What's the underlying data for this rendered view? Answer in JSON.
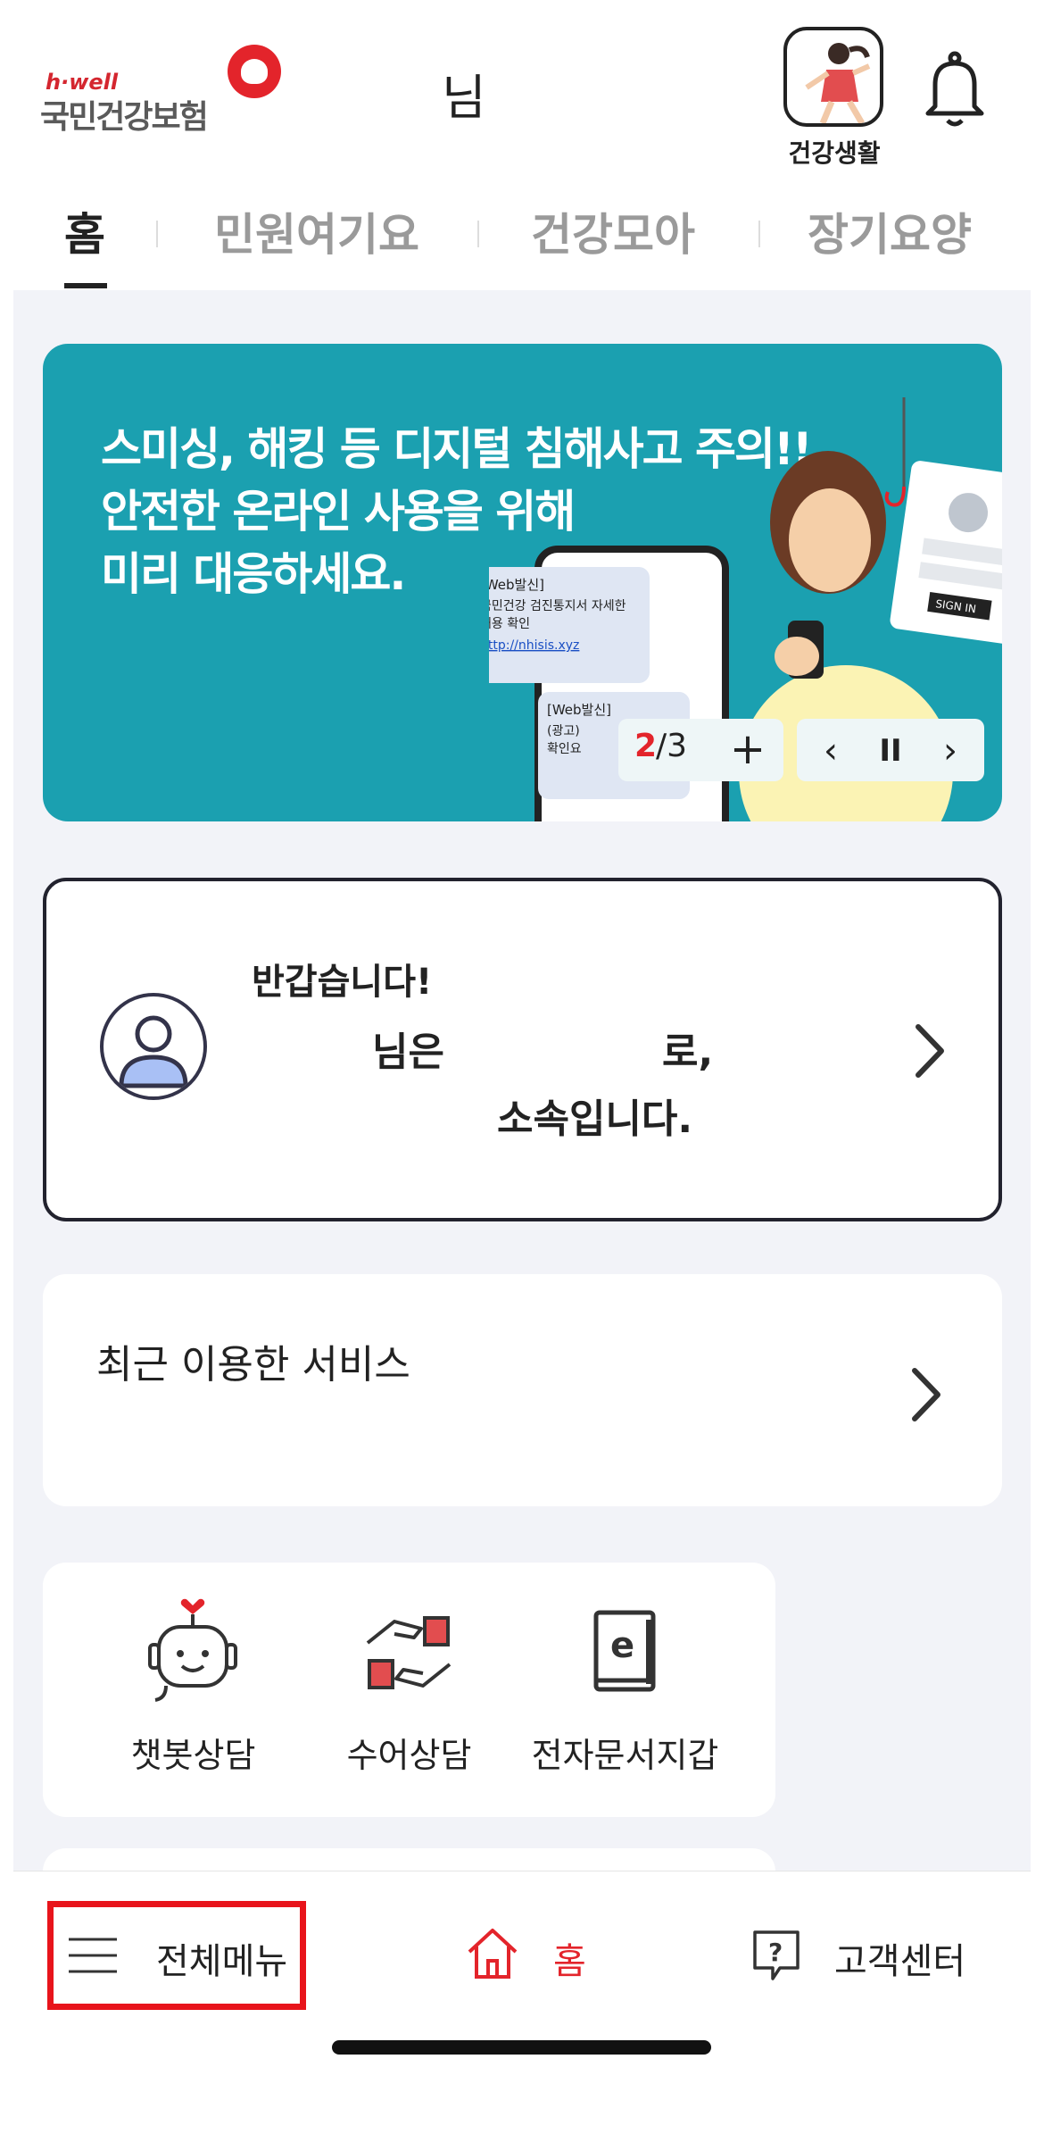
{
  "header": {
    "logo_tagline": "h·well",
    "logo_name": "국민건강보험",
    "username_suffix": "님",
    "life_label": "건강생활"
  },
  "tabs": [
    {
      "label": "홈",
      "active": true
    },
    {
      "label": "민원여기요",
      "active": false
    },
    {
      "label": "건강모아",
      "active": false
    },
    {
      "label": "장기요양",
      "active": false
    }
  ],
  "banner": {
    "lines": [
      "스미싱, 해킹 등 디지털 침해사고 주의!!",
      "안전한 온라인 사용을 위해",
      "미리 대응하세요."
    ],
    "msg1_title": "[Web발신]",
    "msg1_body1": "국민건강 검진통지서 자세한",
    "msg1_body2": "내용 확인",
    "msg1_link": "http://nhisis.xyz",
    "msg2_title": "[Web발신]",
    "msg2_body1": "(광고)",
    "msg2_body2": "확인요",
    "sign_in": "SIGN IN",
    "page_current": "2",
    "page_total": "/3",
    "plus": "+",
    "prev": "‹",
    "pause": "II",
    "next": "›"
  },
  "welcome": {
    "greeting": "반갑습니다!",
    "line2a": "님은",
    "line2b": "로,",
    "line3": "소속입니다."
  },
  "recent": {
    "title": "최근 이용한 서비스"
  },
  "services": [
    {
      "label": "챗봇상담",
      "icon": "chatbot-icon"
    },
    {
      "label": "수어상담",
      "icon": "sign-language-icon"
    },
    {
      "label": "전자문서지갑",
      "icon": "e-document-wallet-icon"
    }
  ],
  "bottom_nav": {
    "menu": "전체메뉴",
    "home": "홈",
    "support": "고객센터"
  },
  "colors": {
    "brand_red": "#e3242b",
    "banner_teal": "#1ba0b0",
    "highlight": "#e8141b"
  }
}
